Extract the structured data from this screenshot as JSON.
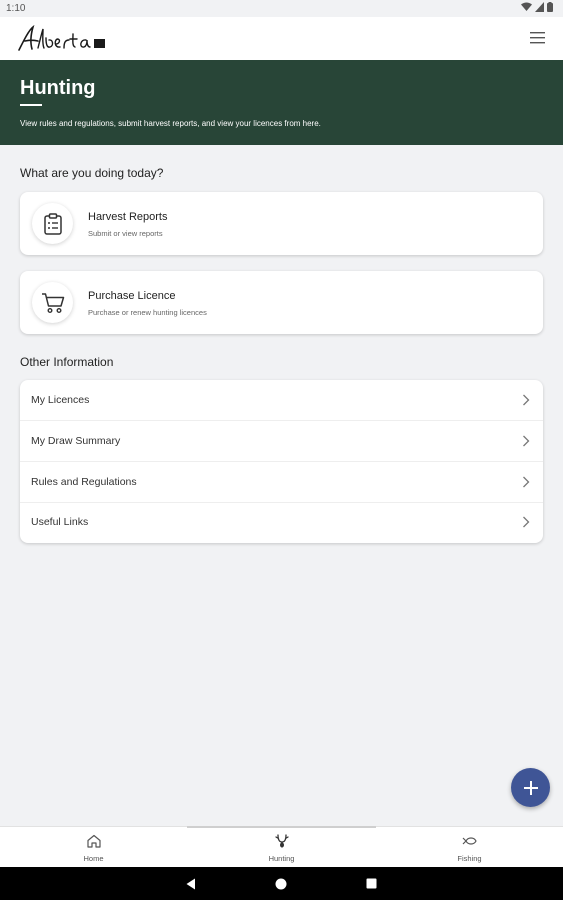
{
  "status_bar": {
    "time": "1:10"
  },
  "header": {
    "logo_alt": "Alberta",
    "menu_icon": "hamburger-menu-icon"
  },
  "hero": {
    "title": "Hunting",
    "description": "View rules and regulations, submit harvest reports, and view your licences from here."
  },
  "actions_section": {
    "title": "What are you doing today?",
    "items": [
      {
        "title": "Harvest Reports",
        "subtitle": "Submit or view reports",
        "icon": "clipboard-icon"
      },
      {
        "title": "Purchase Licence",
        "subtitle": "Purchase or renew hunting licences",
        "icon": "cart-icon"
      }
    ]
  },
  "info_section": {
    "title": "Other Information",
    "items": [
      {
        "label": "My Licences"
      },
      {
        "label": "My Draw Summary"
      },
      {
        "label": "Rules and Regulations"
      },
      {
        "label": "Useful Links"
      }
    ]
  },
  "fab": {
    "icon": "plus-icon"
  },
  "bottom_nav": {
    "items": [
      {
        "label": "Home",
        "icon": "home-icon"
      },
      {
        "label": "Hunting",
        "icon": "antler-icon",
        "active": true
      },
      {
        "label": "Fishing",
        "icon": "fish-icon"
      }
    ]
  },
  "colors": {
    "hero_bg": "#284537",
    "fab_bg": "#3f5596",
    "page_bg": "#f1f2f4"
  }
}
